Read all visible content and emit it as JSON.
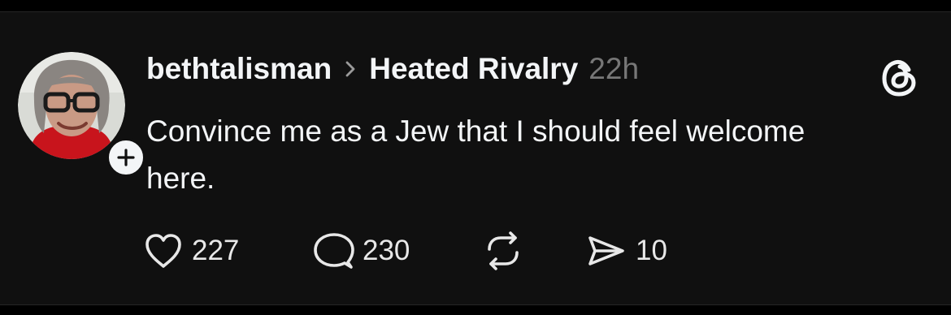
{
  "post": {
    "username": "bethtalisman",
    "community": "Heated Rivalry",
    "time": "22h",
    "text": "Convince me as a Jew that I should feel welcome here.",
    "likes": "227",
    "replies": "230",
    "shares": "10"
  },
  "colors": {
    "background": "#101010",
    "text": "#f3f5f7",
    "muted": "#777777"
  },
  "icons": {
    "follow": "plus-icon",
    "separator": "chevron-right-icon",
    "brand": "threads-logo-icon",
    "like": "heart-icon",
    "reply": "comment-bubble-icon",
    "repost": "repost-icon",
    "share": "send-icon"
  }
}
